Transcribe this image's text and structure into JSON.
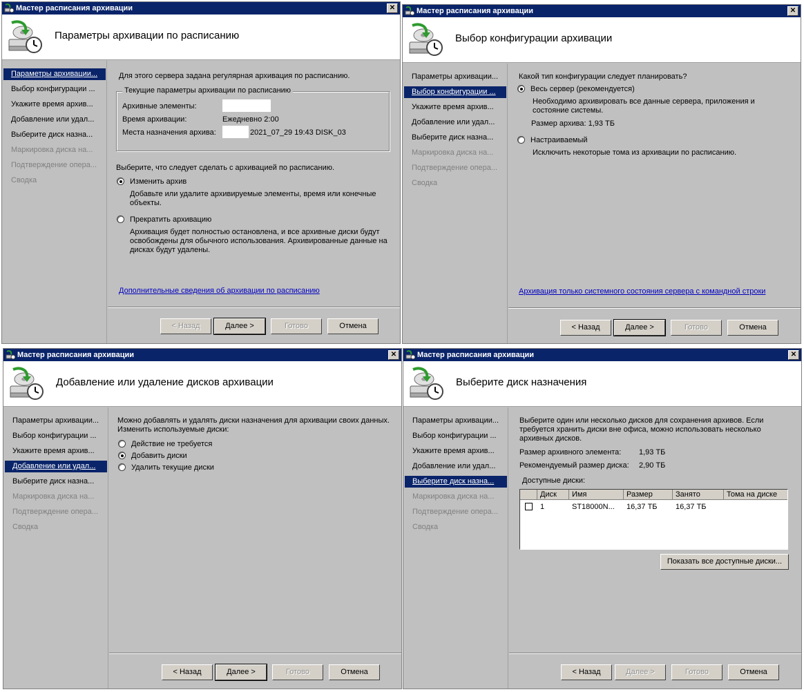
{
  "window_title": "Мастер расписания архивации",
  "nav_items": [
    "Параметры архивации...",
    "Выбор конфигурации ...",
    "Укажите время архив...",
    "Добавление или удал...",
    "Выберите диск назна...",
    "Маркировка диска на...",
    "Подтверждение опера...",
    "Сводка"
  ],
  "buttons": {
    "back": "< Назад",
    "next": "Далее >",
    "finish": "Готово",
    "cancel": "Отмена"
  },
  "p1": {
    "heading": "Параметры архивации по расписанию",
    "intro": "Для этого сервера задана регулярная архивация по расписанию.",
    "group_title": "Текущие параметры архивации по расписанию",
    "items_label": "Архивные элементы:",
    "time_label": "Время архивации:",
    "time_value": "Ежедневно 2:00",
    "dest_label": "Места назначения архива:",
    "dest_value": "2021_07_29 19:43 DISK_03",
    "question": "Выберите, что следует сделать с архивацией по расписанию.",
    "opt1_label": "Изменить архив",
    "opt1_desc": "Добавьте или удалите архивируемые элементы, время или конечные объекты.",
    "opt2_label": "Прекратить архивацию",
    "opt2_desc": "Архивация будет полностью остановлена, и все архивные диски будут освобождены для обычного использования. Архивированные данные на дисках будут удалены.",
    "link": "Дополнительные сведения об архивации по расписанию"
  },
  "p2": {
    "heading": "Выбор конфигурации архивации",
    "question": "Какой тип конфигурации следует планировать?",
    "opt1_label": "Весь сервер (рекомендуется)",
    "opt1_desc": "Необходимо архивировать все данные сервера, приложения и состояние системы.",
    "size_line": "Размер архива: 1,93 ТБ",
    "opt2_label": "Настраиваемый",
    "opt2_desc": "Исключить некоторые тома из архивации по расписанию.",
    "link": "Архивация только системного состояния сервера с командной строки"
  },
  "p3": {
    "heading": "Добавление или удаление дисков архивации",
    "intro": "Можно добавлять и удалять диски назначения для архивации своих данных. Изменить используемые диски:",
    "opt1_label": "Действие не требуется",
    "opt2_label": "Добавить диски",
    "opt3_label": "Удалить текущие диски"
  },
  "p4": {
    "heading": "Выберите диск назначения",
    "intro": "Выберите один или несколько дисков для сохранения архивов. Если требуется хранить диски вне офиса, можно использовать несколько архивных дисков.",
    "size_label": "Размер архивного элемента:",
    "size_value": "1,93 ТБ",
    "rec_label": "Рекомендуемый размер диска:",
    "rec_value": "2,90 ТБ",
    "available_label": "Доступные диски:",
    "columns": [
      "Диск",
      "Имя",
      "Размер",
      "Занято",
      "Тома на диске"
    ],
    "row": {
      "disk": "1",
      "name": "ST18000N...",
      "size": "16,37 ТБ",
      "used": "16,37 ТБ",
      "volumes": ""
    },
    "show_all_button": "Показать все доступные диски..."
  }
}
